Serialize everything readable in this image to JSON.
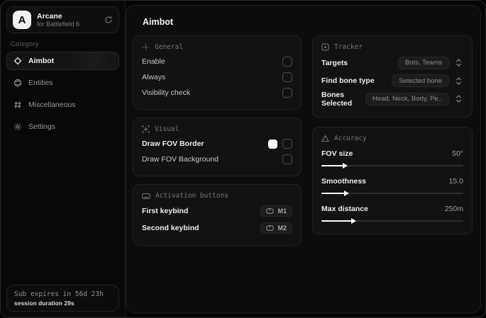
{
  "colors": {
    "accent_swatch": "#ffffff",
    "card_bg": "#121212",
    "panel_bg": "#0d0d0d"
  },
  "sidebar": {
    "app": {
      "logo_letter": "A",
      "name": "Arcane",
      "subtitle": "for Battlefield 6"
    },
    "category_label": "Category",
    "items": [
      {
        "label": "Aimbot",
        "icon": "crosshair-icon",
        "selected": true
      },
      {
        "label": "Entities",
        "icon": "entities-icon",
        "selected": false
      },
      {
        "label": "Miscellaneous",
        "icon": "grid-icon",
        "selected": false
      },
      {
        "label": "Settings",
        "icon": "gear-icon",
        "selected": false
      }
    ],
    "subscription": {
      "expires": "Sub expires in 56d 23h",
      "session": "session duration 29s"
    }
  },
  "main": {
    "title": "Aimbot",
    "general": {
      "title": "General",
      "rows": [
        {
          "label": "Enable",
          "checked": false
        },
        {
          "label": "Always",
          "checked": false
        },
        {
          "label": "Visibility check",
          "checked": false
        }
      ]
    },
    "visual": {
      "title": "Visual",
      "rows": [
        {
          "label": "Draw FOV Border",
          "swatch": "#ffffff",
          "checked": false
        },
        {
          "label": "Draw FOV Background",
          "checked": false
        }
      ]
    },
    "activation": {
      "title": "Activation buttons",
      "rows": [
        {
          "label": "First keybind",
          "key": "M1"
        },
        {
          "label": "Second keybind",
          "key": "M2"
        }
      ]
    },
    "tracker": {
      "title": "Tracker",
      "rows": [
        {
          "label": "Targets",
          "value": "Bots, Teams"
        },
        {
          "label": "Find bone type",
          "value": "Selected bone"
        },
        {
          "label": "Bones Selected",
          "value": "Head, Neck, Body, Pe.."
        }
      ]
    },
    "accuracy": {
      "title": "Accuracy",
      "rows": [
        {
          "label": "FOV size",
          "value": "50°",
          "fill_percent": 15
        },
        {
          "label": "Smoothness",
          "value": "15.0",
          "fill_percent": 16
        },
        {
          "label": "Max distance",
          "value": "250m",
          "fill_percent": 21
        }
      ]
    }
  }
}
